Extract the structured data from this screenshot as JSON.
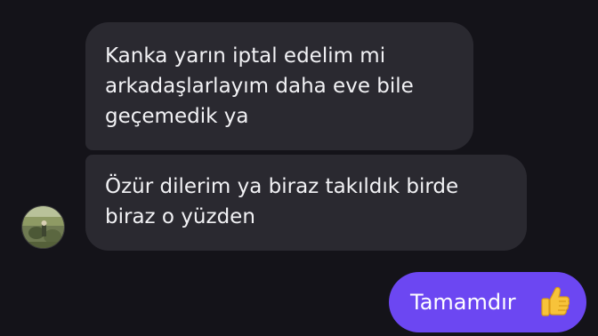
{
  "conversation": {
    "messages": [
      {
        "direction": "incoming",
        "lines": [
          "Kanka yarın iptal edelim mi",
          "arkadaşlarlayım daha eve bile",
          "geçemedik ya"
        ]
      },
      {
        "direction": "incoming",
        "lines": [
          "Özür dilerim ya biraz takıldık birde",
          "biraz o yüzden"
        ]
      },
      {
        "direction": "outgoing",
        "text": "Tamamdır",
        "emoji_icon": "thumbs-up-icon"
      }
    ],
    "avatar_icon": "contact-avatar"
  },
  "colors": {
    "background": "#141319",
    "incoming_bubble": "#2a2930",
    "outgoing_bubble": "#6c47f2",
    "text": "#f2f2f5"
  }
}
